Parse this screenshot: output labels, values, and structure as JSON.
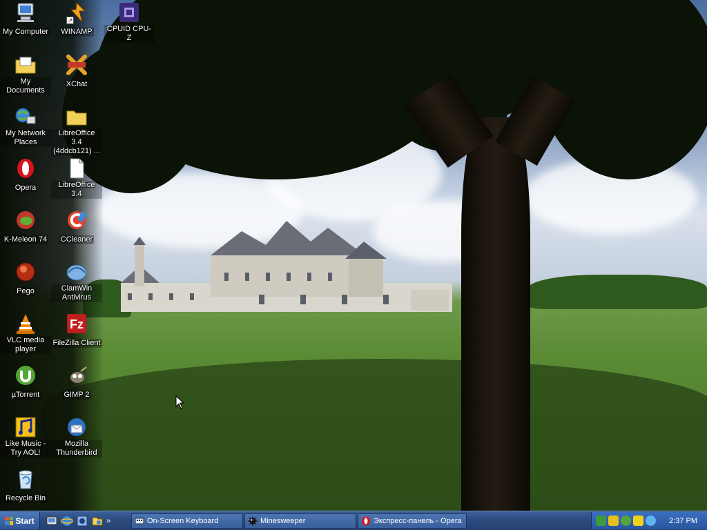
{
  "desktop": {
    "icons": [
      {
        "label": "My Computer",
        "icon": "computer-icon"
      },
      {
        "label": "WINAMP",
        "icon": "winamp-icon"
      },
      {
        "label": "CPUID CPU-Z",
        "icon": "cpuz-icon"
      },
      {
        "label": "My Documents",
        "icon": "documents-folder-icon"
      },
      {
        "label": "XChat",
        "icon": "xchat-icon"
      },
      {
        "label": "My Network Places",
        "icon": "network-icon"
      },
      {
        "label": "LibreOffice 3.4 (4ddcb121) ...",
        "icon": "folder-icon"
      },
      {
        "label": "Opera",
        "icon": "opera-icon"
      },
      {
        "label": "LibreOffice 3.4",
        "icon": "document-icon"
      },
      {
        "label": "K-Meleon 74",
        "icon": "kmeleon-icon"
      },
      {
        "label": "CCleaner",
        "icon": "ccleaner-icon"
      },
      {
        "label": "Pego",
        "icon": "pego-icon"
      },
      {
        "label": "ClamWin Antivirus",
        "icon": "clamwin-icon"
      },
      {
        "label": "VLC media player",
        "icon": "vlc-icon"
      },
      {
        "label": "FileZilla Client",
        "icon": "filezilla-icon"
      },
      {
        "label": "µTorrent",
        "icon": "utorrent-icon"
      },
      {
        "label": "GIMP 2",
        "icon": "gimp-icon"
      },
      {
        "label": "Like Music - Try AOL!",
        "icon": "music-icon"
      },
      {
        "label": "Mozilla Thunderbird",
        "icon": "thunderbird-icon"
      },
      {
        "label": "Recycle Bin",
        "icon": "recycle-bin-icon"
      }
    ]
  },
  "taskbar": {
    "start_label": "Start",
    "quick_launch": [
      "show-desktop-icon",
      "internet-explorer-icon",
      "network-icon",
      "media-icon"
    ],
    "quick_launch_more": "»",
    "tasks": [
      {
        "label": "On-Screen Keyboard",
        "icon": "keyboard-icon"
      },
      {
        "label": "Minesweeper",
        "icon": "mine-icon"
      },
      {
        "label": "Экспресс-панель - Opera",
        "icon": "opera-icon"
      }
    ],
    "clock": "2:37 PM"
  },
  "colors": {
    "taskbar": "#2c4b80",
    "tray": "#2a579e",
    "opera_red": "#d4161c",
    "folder_yellow": "#f2d15a"
  }
}
